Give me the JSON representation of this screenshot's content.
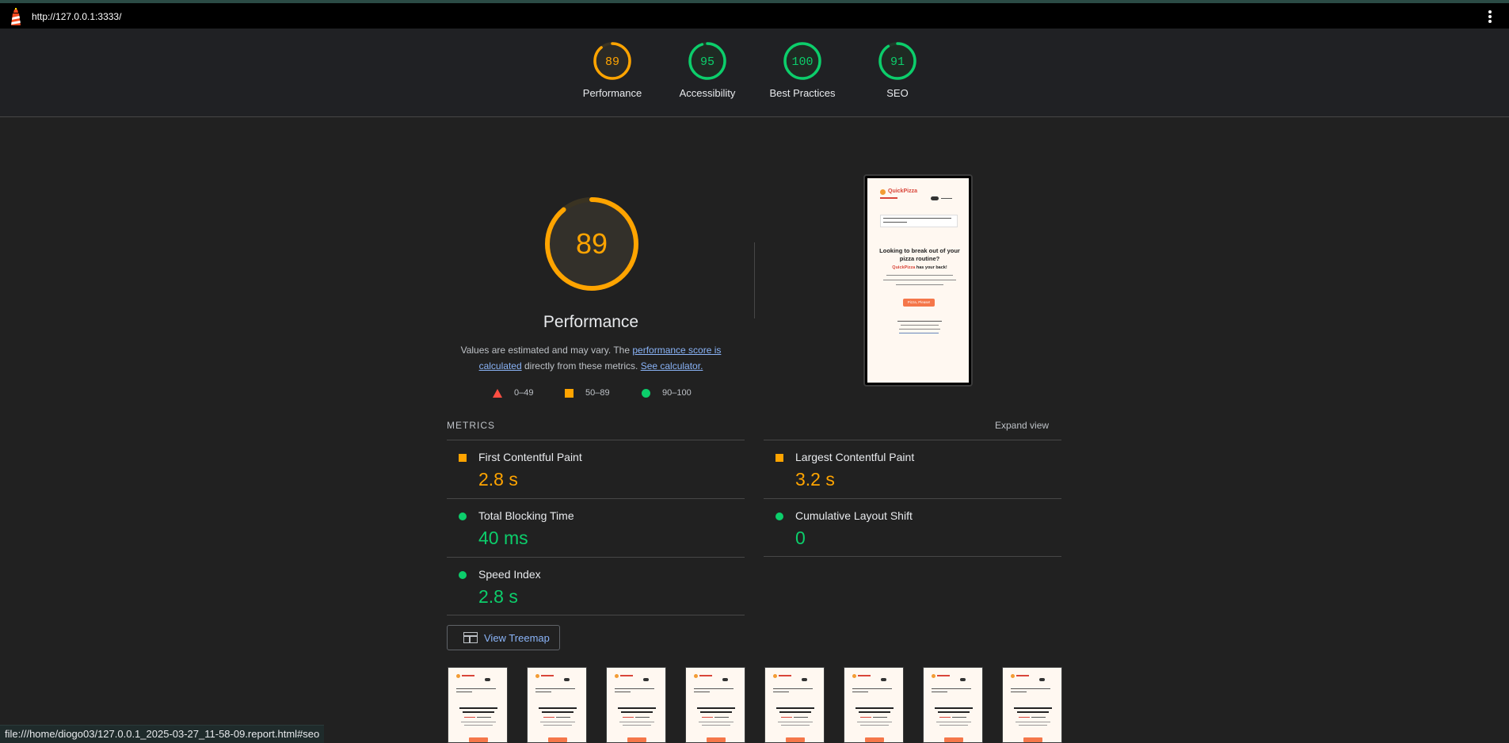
{
  "browser": {
    "url": "http://127.0.0.1:3333/",
    "status_url": "file:///home/diogo03/127.0.0.1_2025-03-27_11-58-09.report.html#seo"
  },
  "categories": [
    {
      "label": "Performance",
      "score": 89,
      "color": "#ffa400"
    },
    {
      "label": "Accessibility",
      "score": 95,
      "color": "#0cce6b"
    },
    {
      "label": "Best Practices",
      "score": 100,
      "color": "#0cce6b"
    },
    {
      "label": "SEO",
      "score": 91,
      "color": "#0cce6b"
    }
  ],
  "performance": {
    "score": 89,
    "title": "Performance",
    "desc_prefix": "Values are estimated and may vary. The ",
    "desc_link1": "performance score is calculated",
    "desc_middle": " directly from these metrics. ",
    "desc_link2": "See calculator.",
    "legend": {
      "fail": "0–49",
      "average": "50–89",
      "pass": "90–100"
    }
  },
  "metrics": {
    "heading": "METRICS",
    "expand": "Expand view",
    "fcp": {
      "name": "First Contentful Paint",
      "value": "2.8 s",
      "status": "average"
    },
    "lcp": {
      "name": "Largest Contentful Paint",
      "value": "3.2 s",
      "status": "average"
    },
    "tbt": {
      "name": "Total Blocking Time",
      "value": "40 ms",
      "status": "pass"
    },
    "cls": {
      "name": "Cumulative Layout Shift",
      "value": "0",
      "status": "pass"
    },
    "si": {
      "name": "Speed Index",
      "value": "2.8 s",
      "status": "pass"
    }
  },
  "treemap": {
    "label": "View Treemap"
  },
  "screenshot": {
    "brand": "QuickPizza",
    "headline": "Looking to break out of your pizza routine?",
    "tagline": "has your back!",
    "cta": "Pizza, Please!"
  },
  "colors": {
    "average": "#ffa400",
    "pass": "#0cce6b",
    "fail": "#ff4e42"
  },
  "icons": {
    "logo": "lighthouse-icon",
    "menu": "kebab-menu-icon",
    "treemap": "treemap-icon"
  }
}
